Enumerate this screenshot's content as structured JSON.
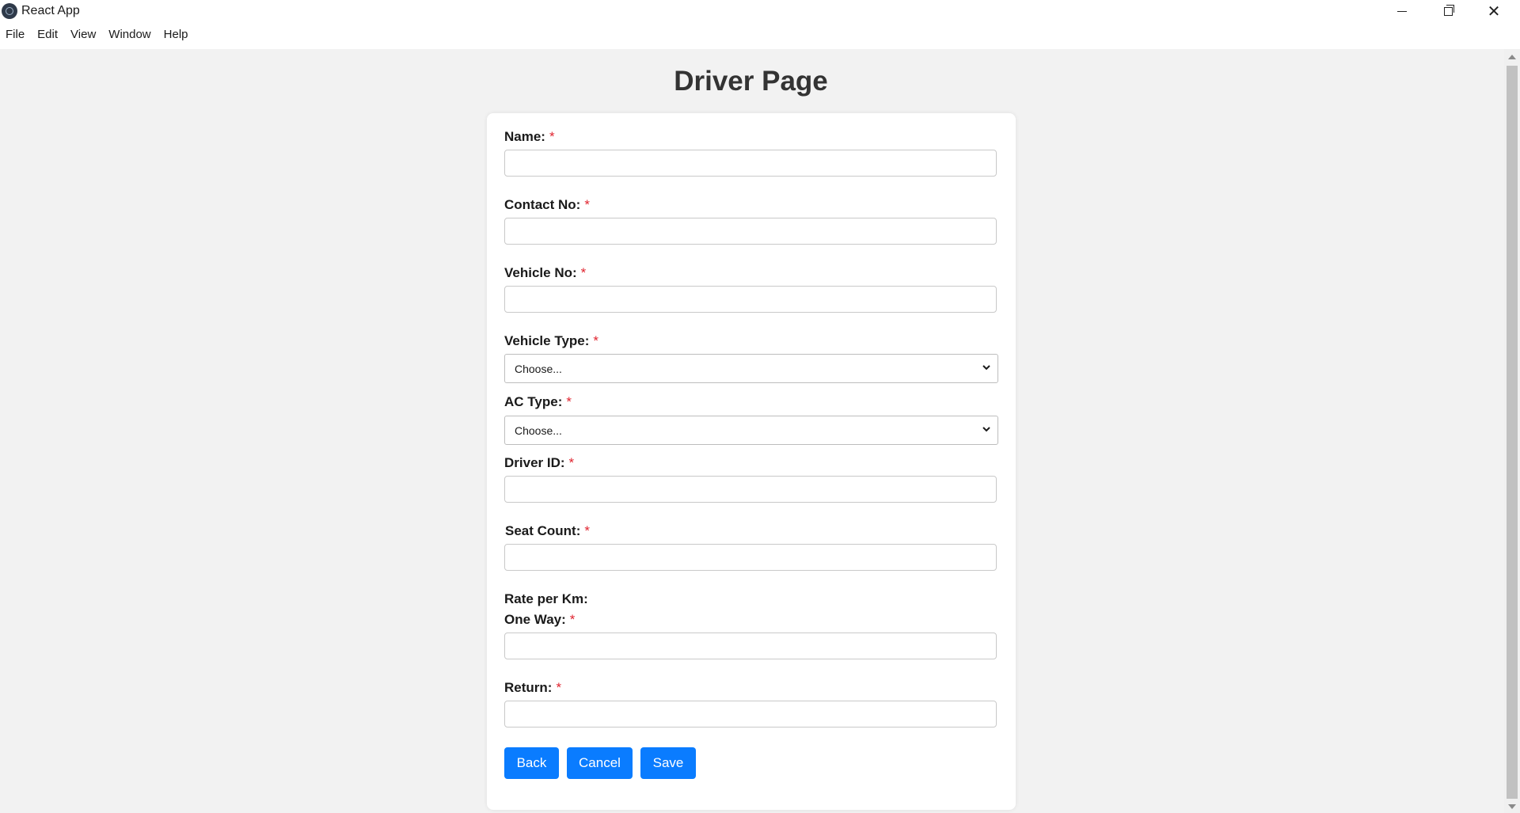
{
  "window": {
    "title": "React App",
    "icon": "electron-icon",
    "controls": [
      "minimize-icon",
      "maximize-icon",
      "close-icon"
    ]
  },
  "menubar": {
    "items": [
      "File",
      "Edit",
      "View",
      "Window",
      "Help"
    ]
  },
  "page": {
    "title": "Driver Page",
    "required_marker": "*",
    "fields": {
      "name": {
        "label": "Name:",
        "value": ""
      },
      "contact_no": {
        "label": "Contact No:",
        "value": ""
      },
      "vehicle_no": {
        "label": "Vehicle No:",
        "value": ""
      },
      "vehicle_type": {
        "label": "Vehicle Type:",
        "selected": "Choose..."
      },
      "ac_type": {
        "label": "AC Type:",
        "selected": "Choose..."
      },
      "driver_id": {
        "label": "Driver ID:",
        "value": ""
      },
      "seat_count": {
        "label": "Seat Count:",
        "value": ""
      },
      "rate_heading": "Rate per Km:",
      "one_way": {
        "label": "One Way:",
        "value": ""
      },
      "return": {
        "label": "Return:",
        "value": ""
      }
    },
    "buttons": {
      "back": "Back",
      "cancel": "Cancel",
      "save": "Save"
    }
  },
  "colors": {
    "accent": "#0a7cff",
    "required": "#e0242f",
    "background": "#f2f2f2",
    "title": "#333333"
  }
}
